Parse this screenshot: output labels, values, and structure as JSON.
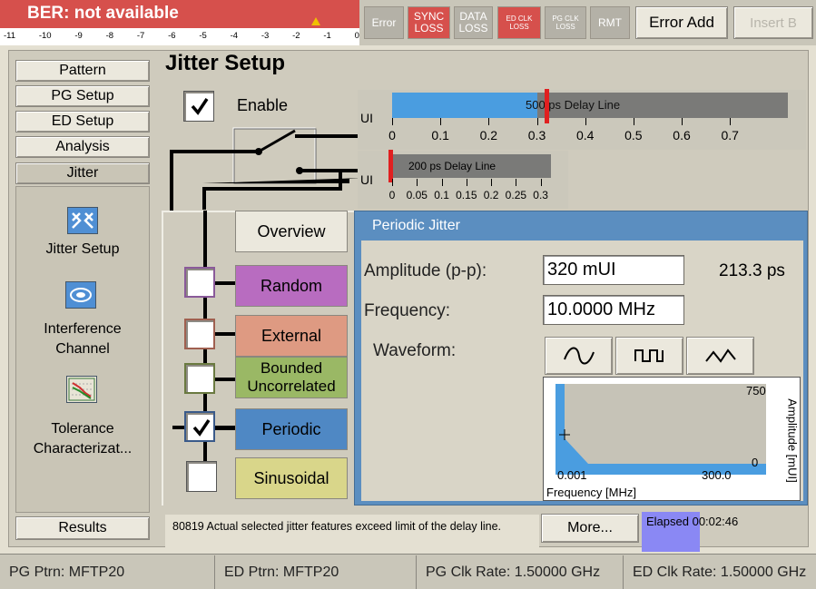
{
  "top": {
    "ber_title": "BER: not available",
    "ber_ticks": [
      "-11",
      "-10",
      "-9",
      "-8",
      "-7",
      "-6",
      "-5",
      "-4",
      "-3",
      "-2",
      "-1",
      "0"
    ],
    "alarms": {
      "error": "Error",
      "sync_loss": [
        "SYNC",
        "LOSS"
      ],
      "data_loss": [
        "DATA",
        "LOSS"
      ],
      "ed_clk_loss": [
        "ED CLK",
        "LOSS"
      ],
      "pg_clk_loss": [
        "PG CLK",
        "LOSS"
      ],
      "rmt": "RMT"
    },
    "error_add": "Error Add",
    "insert_b": "Insert B"
  },
  "nav": {
    "pattern": "Pattern",
    "pg_setup": "PG Setup",
    "ed_setup": "ED Setup",
    "analysis": "Analysis",
    "jitter": "Jitter",
    "results": "Results",
    "sub": [
      "Jitter Setup",
      "Interference Channel",
      "Tolerance Characterizat..."
    ]
  },
  "page_title": "Jitter Setup",
  "enable": {
    "label": "Enable",
    "checked": true
  },
  "delay_500": {
    "label": "500 ps Delay Line",
    "unit": "UI",
    "ticks": [
      "0",
      "0.1",
      "0.2",
      "0.3",
      "0.4",
      "0.5",
      "0.6",
      "0.7"
    ],
    "range": [
      0,
      0.82
    ],
    "fill_value": 0.3,
    "marker_value": 0.32
  },
  "delay_200": {
    "label": "200 ps Delay Line",
    "unit": "UI",
    "ticks": [
      "0",
      "0.05",
      "0.1",
      "0.15",
      "0.2",
      "0.25",
      "0.3"
    ],
    "range": [
      0,
      0.33
    ],
    "marker_value": 0.0
  },
  "tabs": {
    "overview": "Overview",
    "random": "Random",
    "external": "External",
    "bounded": "Bounded Uncorrelated",
    "periodic": "Periodic",
    "sinusoidal": "Sinusoidal"
  },
  "checks": {
    "random": false,
    "external": false,
    "bounded": false,
    "periodic": true,
    "sinusoidal": false
  },
  "panel": {
    "title": "Periodic Jitter",
    "amplitude_label": "Amplitude (p-p):",
    "amplitude_value": "320 mUI",
    "amplitude_ps": "213.3 ps",
    "frequency_label": "Frequency:",
    "frequency_value": "10.0000 MHz",
    "waveform_label": "Waveform:",
    "waveforms": [
      "sine-wave-icon",
      "square-wave-icon",
      "triangle-wave-icon"
    ],
    "plot": {
      "y_max": "750",
      "y_min": "0",
      "x_min": "0.001",
      "x_max": "300.0",
      "xlabel": "Frequency [MHz]",
      "ylabel": "Amplitude [mUI]"
    }
  },
  "status_message": "80819 Actual selected jitter features exceed limit of the delay line.",
  "more": "More...",
  "elapsed": "Elapsed 00:02:46",
  "bottom": {
    "pg_ptrn": "PG Ptrn: MFTP20",
    "ed_ptrn": "ED Ptrn: MFTP20",
    "pg_clk": "PG Clk Rate: 1.50000 GHz",
    "ed_clk": "ED Clk Rate: 1.50000 GHz"
  },
  "colors": {
    "accent_red": "#d6504c",
    "tab_blue": "#4f88c4",
    "elapsed": "#8a88f4",
    "delay_fill": "#4a9de0",
    "marker": "#e02020"
  }
}
